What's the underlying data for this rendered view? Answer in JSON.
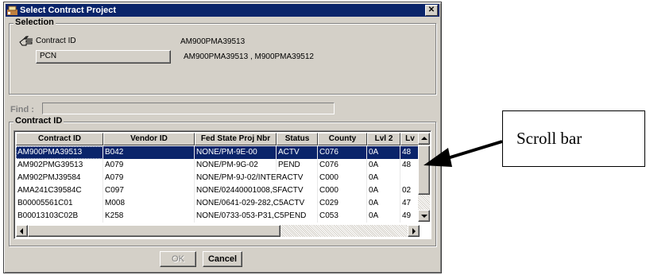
{
  "window": {
    "title": "Select Contract Project",
    "close_glyph": "✕"
  },
  "selection": {
    "label": "Selection",
    "contract_id_button": "Contract ID",
    "contract_id_value": "AM900PMA39513",
    "pcn_button": "PCN",
    "pcn_value": "AM900PMA39513 , M900PMA39512"
  },
  "find": {
    "label": "Find :",
    "value": ""
  },
  "contract_group": {
    "label": "Contract ID",
    "columns": [
      "Contract ID",
      "Vendor ID",
      "Fed State Proj Nbr",
      "Status",
      "County",
      "Lvl 2",
      "Lv"
    ],
    "rows": [
      [
        "AM900PMA39513",
        "B042",
        "NONE/PM-9E-00",
        "ACTV",
        "C076",
        "0A",
        "48"
      ],
      [
        "AM902PMG39513",
        "A079",
        "NONE/PM-9G-02",
        "PEND",
        "C076",
        "0A",
        "48"
      ],
      [
        "AM902PMJ39584",
        "A079",
        "NONE/PM-9J-02/INTERACTV",
        "",
        "C000",
        "0A",
        ""
      ],
      [
        "AMA241C39584C",
        "C097",
        "NONE/02440001008,SFACTV",
        "",
        "C000",
        "0A",
        "02"
      ],
      [
        "B00005561C01",
        "M008",
        "NONE/0641-029-282,C5ACTV",
        "",
        "C029",
        "0A",
        "47"
      ],
      [
        "B00013103C02B",
        "K258",
        "NONE/0733-053-P31,C5PEND",
        "",
        "C053",
        "0A",
        "49"
      ]
    ],
    "selected_row": 0
  },
  "buttons": {
    "ok": "OK",
    "cancel": "Cancel"
  },
  "annotation": {
    "text": "Scroll bar"
  },
  "icons": {
    "app": "window-app-icon",
    "pointer": "pointing-hand-icon",
    "scroll_up": "scroll-up-arrow-icon",
    "scroll_down": "scroll-down-arrow-icon",
    "scroll_left": "scroll-left-arrow-icon",
    "scroll_right": "scroll-right-arrow-icon"
  },
  "colors": {
    "titlebar": "#0a246a",
    "selection": "#0a246a",
    "face": "#d4d0c8"
  }
}
